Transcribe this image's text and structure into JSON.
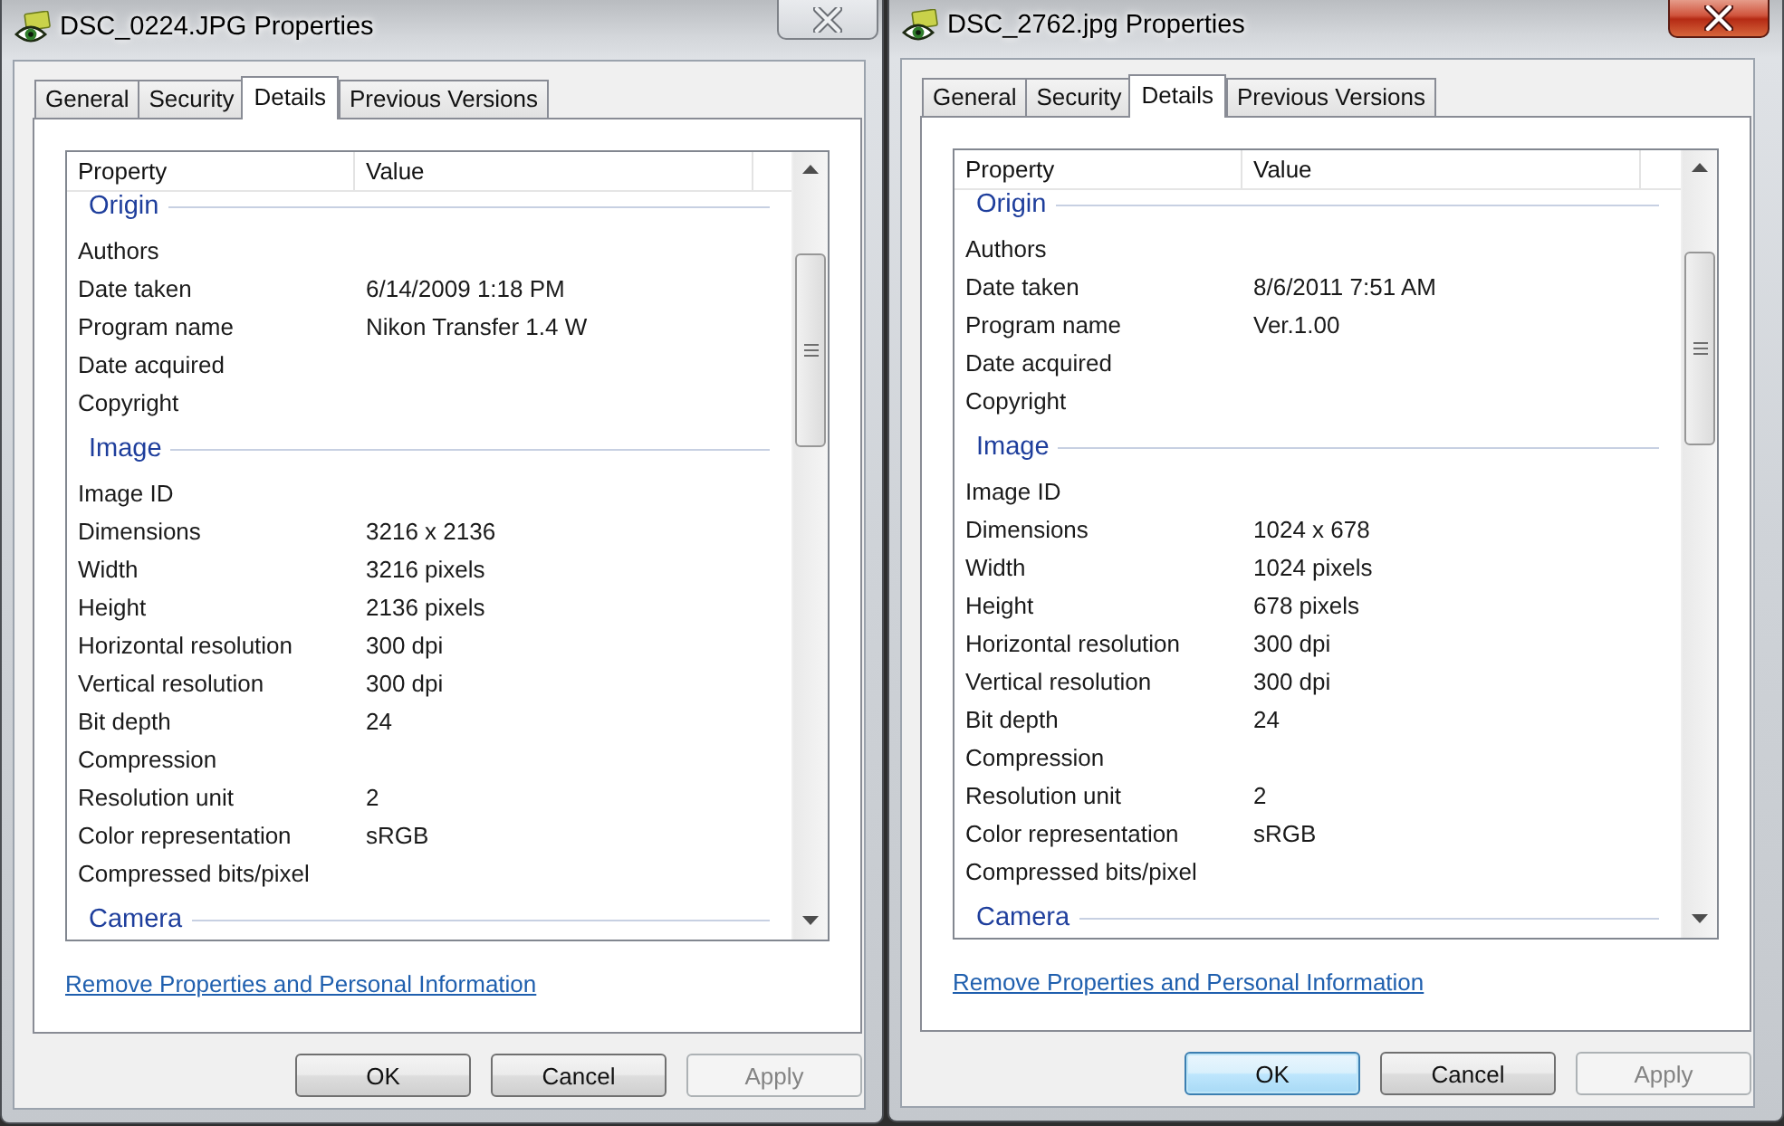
{
  "dialogs": [
    {
      "title": "DSC_0224.JPG Properties",
      "active": false,
      "tabs": [
        {
          "label": "General",
          "selected": false
        },
        {
          "label": "Security",
          "selected": false
        },
        {
          "label": "Details",
          "selected": true
        },
        {
          "label": "Previous Versions",
          "selected": false
        }
      ],
      "columns": [
        "Property",
        "Value"
      ],
      "groups": [
        {
          "heading": "Origin",
          "rows": [
            {
              "property": "Authors"
            },
            {
              "property": "Date taken",
              "value": "6/14/2009 1:18 PM"
            },
            {
              "property": "Program name",
              "value": "Nikon Transfer 1.4 W"
            },
            {
              "property": "Date acquired"
            },
            {
              "property": "Copyright"
            }
          ]
        },
        {
          "heading": "Image",
          "rows": [
            {
              "property": "Image ID"
            },
            {
              "property": "Dimensions",
              "value": "3216 x 2136"
            },
            {
              "property": "Width",
              "value": "3216 pixels"
            },
            {
              "property": "Height",
              "value": "2136 pixels"
            },
            {
              "property": "Horizontal resolution",
              "value": "300 dpi"
            },
            {
              "property": "Vertical resolution",
              "value": "300 dpi"
            },
            {
              "property": "Bit depth",
              "value": "24"
            },
            {
              "property": "Compression"
            },
            {
              "property": "Resolution unit",
              "value": "2"
            },
            {
              "property": "Color representation",
              "value": "sRGB"
            },
            {
              "property": "Compressed bits/pixel"
            }
          ]
        },
        {
          "heading": "Camera"
        }
      ],
      "link": "Remove Properties and Personal Information",
      "buttons": [
        {
          "label": "OK",
          "focused": false,
          "disabled": false
        },
        {
          "label": "Cancel",
          "focused": false,
          "disabled": false
        },
        {
          "label": "Apply",
          "focused": false,
          "disabled": true
        }
      ]
    },
    {
      "title": "DSC_2762.jpg Properties",
      "active": true,
      "tabs": [
        {
          "label": "General",
          "selected": false
        },
        {
          "label": "Security",
          "selected": false
        },
        {
          "label": "Details",
          "selected": true
        },
        {
          "label": "Previous Versions",
          "selected": false
        }
      ],
      "columns": [
        "Property",
        "Value"
      ],
      "groups": [
        {
          "heading": "Origin",
          "rows": [
            {
              "property": "Authors"
            },
            {
              "property": "Date taken",
              "value": "8/6/2011 7:51 AM"
            },
            {
              "property": "Program name",
              "value": "Ver.1.00"
            },
            {
              "property": "Date acquired"
            },
            {
              "property": "Copyright"
            }
          ]
        },
        {
          "heading": "Image",
          "rows": [
            {
              "property": "Image ID"
            },
            {
              "property": "Dimensions",
              "value": "1024 x 678"
            },
            {
              "property": "Width",
              "value": "1024 pixels"
            },
            {
              "property": "Height",
              "value": "678 pixels"
            },
            {
              "property": "Horizontal resolution",
              "value": "300 dpi"
            },
            {
              "property": "Vertical resolution",
              "value": "300 dpi"
            },
            {
              "property": "Bit depth",
              "value": "24"
            },
            {
              "property": "Compression"
            },
            {
              "property": "Resolution unit",
              "value": "2"
            },
            {
              "property": "Color representation",
              "value": "sRGB"
            },
            {
              "property": "Compressed bits/pixel"
            }
          ]
        },
        {
          "heading": "Camera"
        }
      ],
      "link": "Remove Properties and Personal Information",
      "buttons": [
        {
          "label": "OK",
          "focused": true,
          "disabled": false
        },
        {
          "label": "Cancel",
          "focused": false,
          "disabled": false
        },
        {
          "label": "Apply",
          "focused": false,
          "disabled": true
        }
      ]
    }
  ]
}
